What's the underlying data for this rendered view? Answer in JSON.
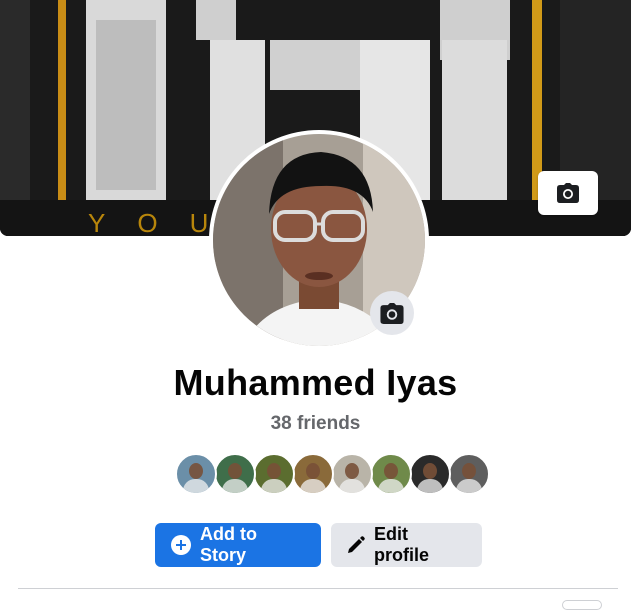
{
  "profile": {
    "name": "Muhammed Iyas",
    "friends_count": "38 friends"
  },
  "cover": {
    "camera_icon": "camera-icon"
  },
  "avatar": {
    "camera_icon": "camera-icon"
  },
  "friend_avatars": [
    {
      "name": "friend-avatar-1",
      "color": "#6b8fa8"
    },
    {
      "name": "friend-avatar-2",
      "color": "#3f6e4a"
    },
    {
      "name": "friend-avatar-3",
      "color": "#5b6d2f"
    },
    {
      "name": "friend-avatar-4",
      "color": "#8a6a3a"
    },
    {
      "name": "friend-avatar-5",
      "color": "#b9b4a8"
    },
    {
      "name": "friend-avatar-6",
      "color": "#6f8a4a"
    },
    {
      "name": "friend-avatar-7",
      "color": "#2a2a2a"
    },
    {
      "name": "friend-avatar-8",
      "color": "#5e5e5e"
    }
  ],
  "actions": {
    "add_story": {
      "label": "Add to Story",
      "icon": "plus-circle-icon"
    },
    "edit_profile": {
      "label": "Edit profile",
      "icon": "pencil-icon"
    }
  },
  "colors": {
    "primary": "#1b74e4",
    "secondary_bg": "#e4e6eb",
    "text": "#050505",
    "muted": "#65676b"
  }
}
